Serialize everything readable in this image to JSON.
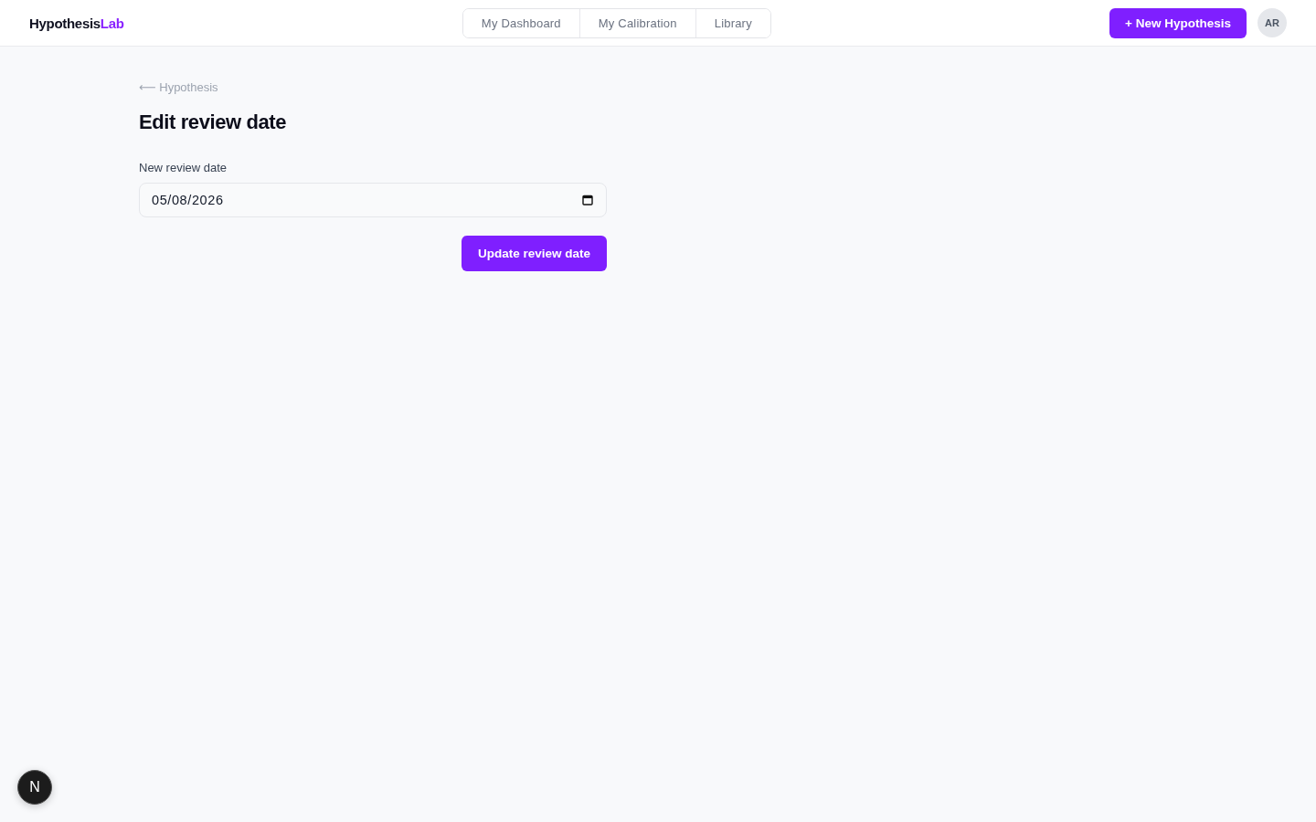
{
  "header": {
    "brand": {
      "name": "Hypothesis",
      "accent": "Lab"
    },
    "nav": [
      {
        "label": "My Dashboard",
        "selected": false
      },
      {
        "label": "My Calibration",
        "selected": false
      },
      {
        "label": "Library",
        "selected": false
      }
    ],
    "new_button": {
      "label": "+ New Hypothesis"
    },
    "avatar": {
      "initials": "AR"
    }
  },
  "page": {
    "back_link": {
      "label": "⟵ Hypothesis"
    },
    "title": "Edit review date",
    "form": {
      "field": {
        "label": "New review date",
        "value": "05/08/2026"
      },
      "submit": {
        "label": "Update review date"
      }
    }
  },
  "dev_badge": {
    "label": "N"
  }
}
